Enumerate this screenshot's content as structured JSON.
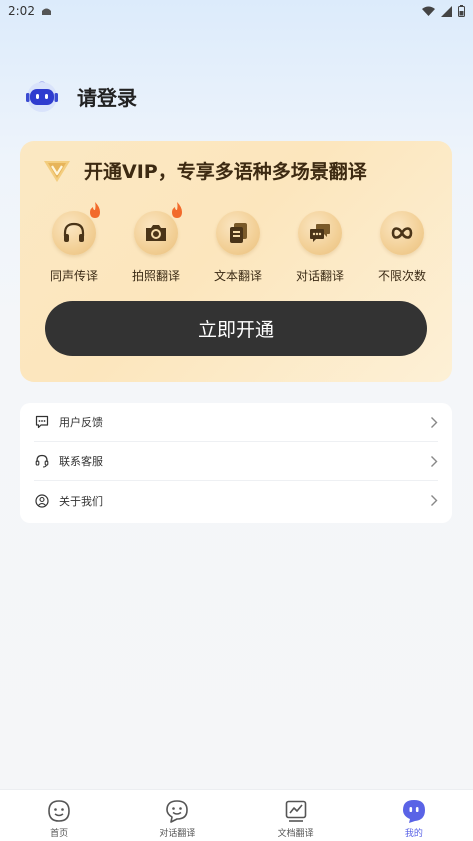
{
  "status_bar": {
    "time": "2:02"
  },
  "profile": {
    "login_text": "请登录"
  },
  "vip": {
    "title": "开通VIP，专享多语种多场景翻译",
    "features": [
      {
        "label": "同声传译",
        "icon": "headphones-icon",
        "hot": true
      },
      {
        "label": "拍照翻译",
        "icon": "camera-icon",
        "hot": true
      },
      {
        "label": "文本翻译",
        "icon": "document-icon",
        "hot": false
      },
      {
        "label": "对话翻译",
        "icon": "chat-icon",
        "hot": false
      },
      {
        "label": "不限次数",
        "icon": "infinity-icon",
        "hot": false
      }
    ],
    "button_label": "立即开通",
    "colors": {
      "button": "#333333",
      "gold": "#c98a2e",
      "fire": "#f26a2b"
    }
  },
  "menu": {
    "items": [
      {
        "label": "用户反馈",
        "icon": "feedback-icon"
      },
      {
        "label": "联系客服",
        "icon": "headset-icon"
      },
      {
        "label": "关于我们",
        "icon": "user-circle-icon"
      }
    ]
  },
  "tab_bar": {
    "tabs": [
      {
        "label": "首页",
        "icon": "home-face-icon",
        "active": false
      },
      {
        "label": "对话翻译",
        "icon": "smile-chat-icon",
        "active": false
      },
      {
        "label": "文档翻译",
        "icon": "chart-doc-icon",
        "active": false
      },
      {
        "label": "我的",
        "icon": "profile-face-icon",
        "active": true
      }
    ],
    "active_color": "#5a63e6"
  }
}
